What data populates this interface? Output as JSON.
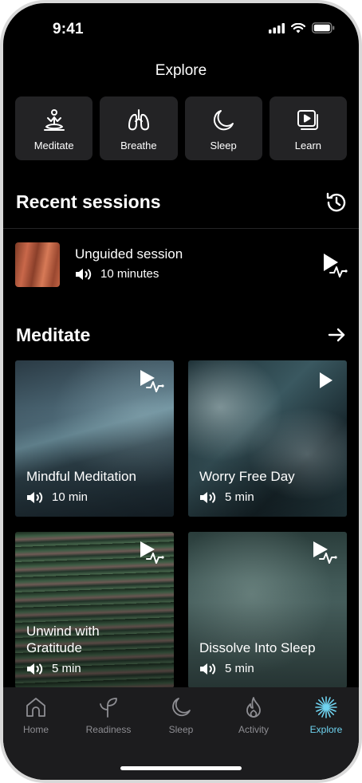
{
  "status": {
    "time": "9:41"
  },
  "header": {
    "title": "Explore"
  },
  "categories": [
    {
      "label": "Meditate",
      "icon": "meditate-icon"
    },
    {
      "label": "Breathe",
      "icon": "lungs-icon"
    },
    {
      "label": "Sleep",
      "icon": "moon-icon"
    },
    {
      "label": "Learn",
      "icon": "play-stack-icon"
    }
  ],
  "recent": {
    "heading": "Recent sessions",
    "item": {
      "title": "Unguided session",
      "duration": "10 minutes"
    }
  },
  "meditate": {
    "heading": "Meditate",
    "cards": [
      {
        "title": "Mindful Meditation",
        "duration": "10 min"
      },
      {
        "title": "Worry Free Day",
        "duration": "5 min"
      },
      {
        "title": "Unwind with Gratitude",
        "duration": "5 min"
      },
      {
        "title": "Dissolve Into Sleep",
        "duration": "5 min"
      }
    ]
  },
  "tabs": [
    {
      "label": "Home",
      "active": false
    },
    {
      "label": "Readiness",
      "active": false
    },
    {
      "label": "Sleep",
      "active": false
    },
    {
      "label": "Activity",
      "active": false
    },
    {
      "label": "Explore",
      "active": true
    }
  ],
  "colors": {
    "accent": "#6fd3f0",
    "background": "#000000",
    "tile": "#232325",
    "tabbar": "#1c1c1e"
  }
}
